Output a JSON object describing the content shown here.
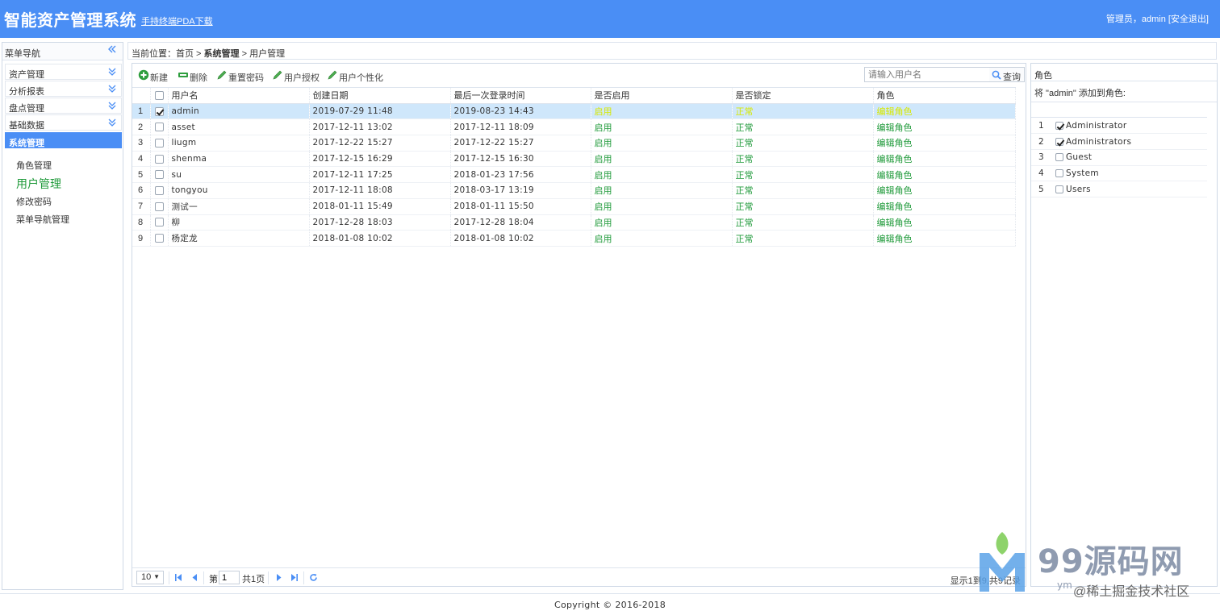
{
  "header": {
    "title": "智能资产管理系统",
    "pda_link": "手持终端PDA下载",
    "user_info": "管理员，admin [安全退出]",
    "bg_color": "#4a8ef5"
  },
  "sidebar": {
    "title": "菜单导航",
    "groups": [
      {
        "label": "资产管理"
      },
      {
        "label": "分析报表"
      },
      {
        "label": "盘点管理"
      },
      {
        "label": "基础数据"
      },
      {
        "label": "系统管理",
        "active": true
      }
    ],
    "sub_items": [
      {
        "label": "角色管理"
      },
      {
        "label": "用户管理",
        "current": true
      },
      {
        "label": "修改密码"
      },
      {
        "label": "菜单导航管理"
      }
    ]
  },
  "breadcrumb": {
    "prefix": "当前位置：首页 > ",
    "section": "系统管理",
    "sep": " > ",
    "page": "用户管理"
  },
  "toolbar": {
    "new_label": "新建",
    "delete_label": "删除",
    "reset_pwd_label": "重置密码",
    "auth_label": "用户授权",
    "personalize_label": "用户个性化",
    "search_placeholder": "请输入用户名",
    "search_label": "查询"
  },
  "table": {
    "columns": [
      "用户名",
      "创建日期",
      "最后一次登录时间",
      "是否启用",
      "是否锁定",
      "角色"
    ],
    "rows": [
      {
        "num": "1",
        "checked": true,
        "username": "admin",
        "created": "2019-07-29 11:48",
        "last_login": "2019-08-23 14:43",
        "enabled": "启用",
        "locked": "正常",
        "role": "编辑角色",
        "selected": true
      },
      {
        "num": "2",
        "checked": false,
        "username": "asset",
        "created": "2017-12-11 13:02",
        "last_login": "2017-12-11 18:09",
        "enabled": "启用",
        "locked": "正常",
        "role": "编辑角色"
      },
      {
        "num": "3",
        "checked": false,
        "username": "liugm",
        "created": "2017-12-22 15:27",
        "last_login": "2017-12-22 15:27",
        "enabled": "启用",
        "locked": "正常",
        "role": "编辑角色"
      },
      {
        "num": "4",
        "checked": false,
        "username": "shenma",
        "created": "2017-12-15 16:29",
        "last_login": "2017-12-15 16:30",
        "enabled": "启用",
        "locked": "正常",
        "role": "编辑角色"
      },
      {
        "num": "5",
        "checked": false,
        "username": "su",
        "created": "2017-12-11 17:25",
        "last_login": "2018-01-23 17:56",
        "enabled": "启用",
        "locked": "正常",
        "role": "编辑角色"
      },
      {
        "num": "6",
        "checked": false,
        "username": "tongyou",
        "created": "2017-12-11 18:08",
        "last_login": "2018-03-17 13:19",
        "enabled": "启用",
        "locked": "正常",
        "role": "编辑角色"
      },
      {
        "num": "7",
        "checked": false,
        "username": "测试一",
        "created": "2018-01-11 15:49",
        "last_login": "2018-01-11 15:50",
        "enabled": "启用",
        "locked": "正常",
        "role": "编辑角色"
      },
      {
        "num": "8",
        "checked": false,
        "username": "柳",
        "created": "2017-12-28 18:03",
        "last_login": "2017-12-28 18:04",
        "enabled": "启用",
        "locked": "正常",
        "role": "编辑角色"
      },
      {
        "num": "9",
        "checked": false,
        "username": "杨定龙",
        "created": "2018-01-08 10:02",
        "last_login": "2018-01-08 10:02",
        "enabled": "启用",
        "locked": "正常",
        "role": "编辑角色"
      }
    ]
  },
  "pager": {
    "page_size": "10",
    "page_label": "第",
    "page_value": "1",
    "page_total": "共1页",
    "info": "显示1到9,共9记录"
  },
  "role_panel": {
    "title": "角色",
    "hint": "将 \"admin\" 添加到角色:",
    "roles": [
      {
        "num": "1",
        "name": "Administrator",
        "checked": true
      },
      {
        "num": "2",
        "name": "Administrators",
        "checked": true
      },
      {
        "num": "3",
        "name": "Guest",
        "checked": false
      },
      {
        "num": "4",
        "name": "System",
        "checked": false
      },
      {
        "num": "5",
        "name": "Users",
        "checked": false
      }
    ]
  },
  "footer": {
    "copyright": "Copyright © 2016-2018"
  },
  "watermark": {
    "text": "99源码网",
    "sub": "ym",
    "sub2": "@稀土掘金技术社区"
  },
  "colors": {
    "accent": "#4a8ef5",
    "status_green": "#1f9a3a",
    "selected_row": "#cfe7fb"
  }
}
